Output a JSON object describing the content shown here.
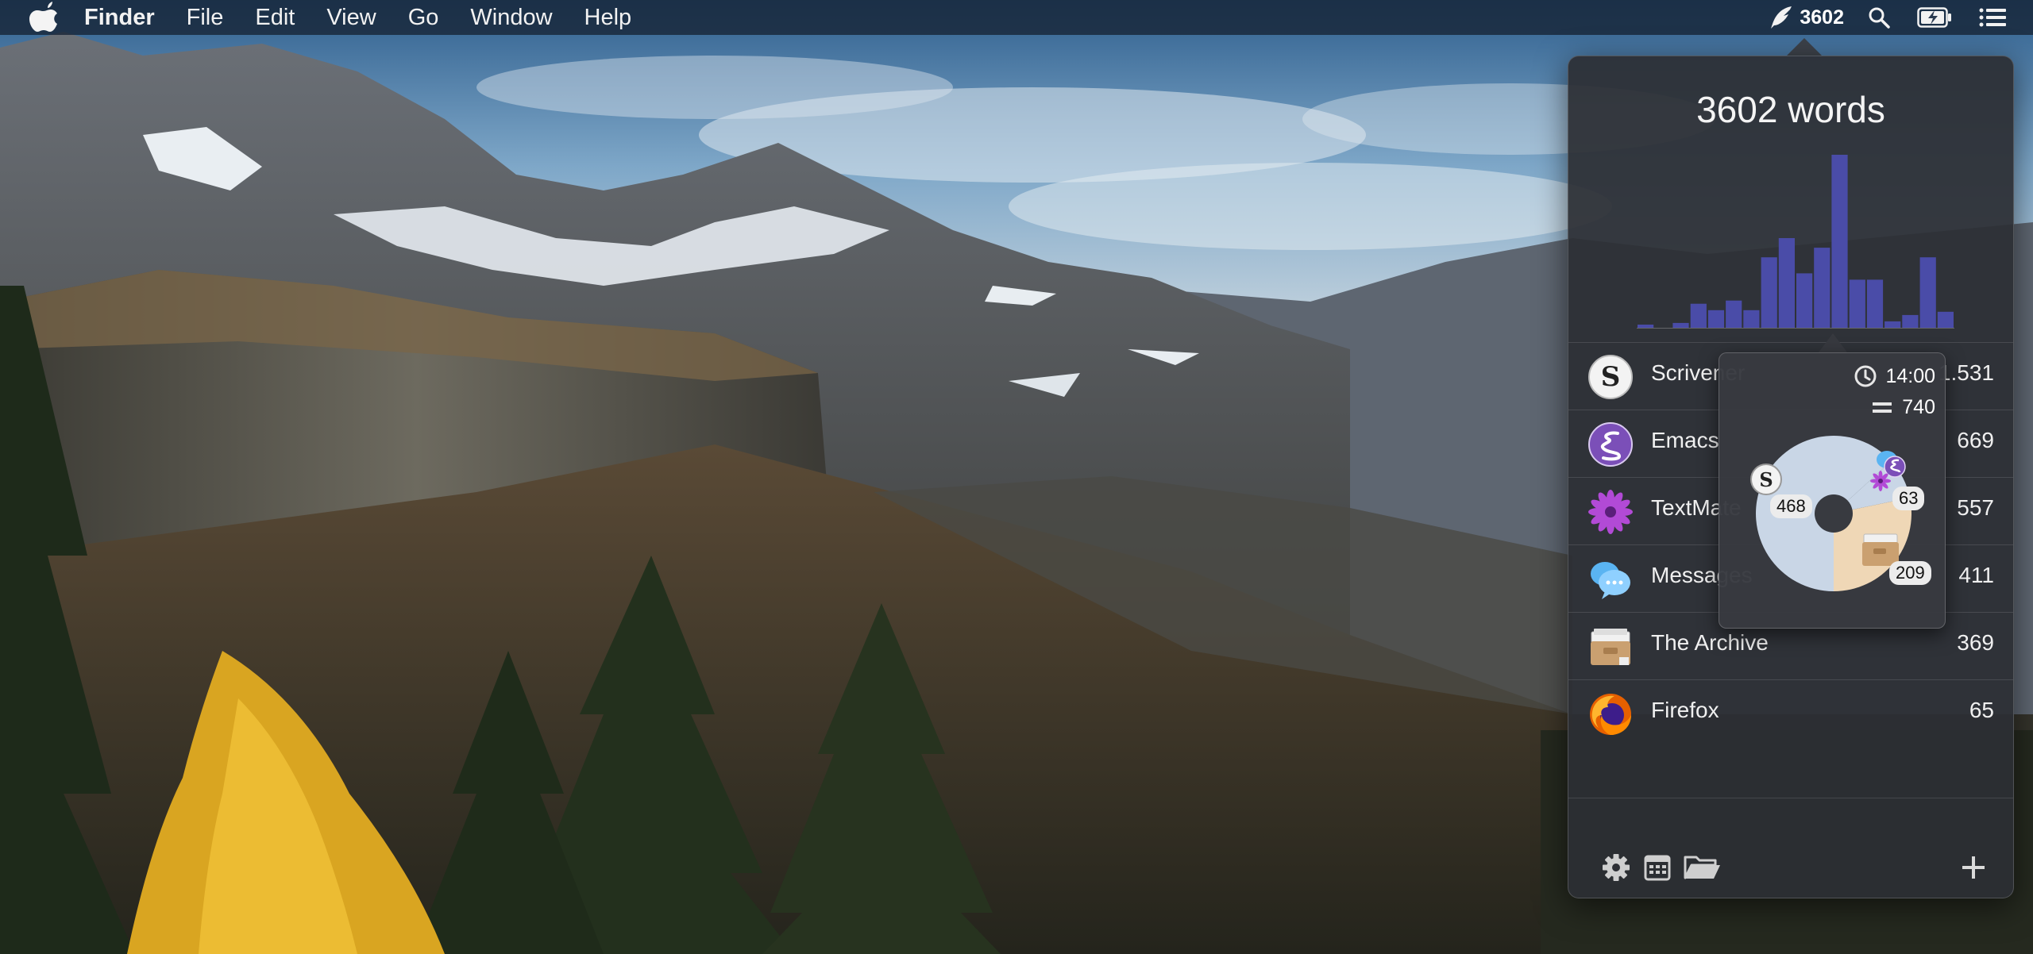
{
  "menubar": {
    "apple_icon": "apple-logo-icon",
    "app_name": "Finder",
    "menus": [
      "File",
      "Edit",
      "View",
      "Go",
      "Window",
      "Help"
    ],
    "status_word_count": "3602",
    "status_icons": [
      "quill-icon",
      "search-icon",
      "battery-charging-icon",
      "list-icon"
    ]
  },
  "popover": {
    "title": "3602 words",
    "histogram": {
      "type": "bar",
      "values": [
        2,
        0,
        3,
        15,
        11,
        17,
        11,
        44,
        56,
        34,
        50,
        108,
        30,
        30,
        4,
        8,
        44,
        10
      ],
      "color": "#4a4ca8"
    },
    "apps": [
      {
        "name": "Scrivener",
        "count": "1.531",
        "icon": "scrivener-icon"
      },
      {
        "name": "Emacs",
        "count": "669",
        "icon": "emacs-icon"
      },
      {
        "name": "TextMate",
        "count": "557",
        "icon": "textmate-icon"
      },
      {
        "name": "Messages",
        "count": "411",
        "icon": "messages-icon"
      },
      {
        "name": "The Archive",
        "count": "369",
        "icon": "the-archive-icon"
      },
      {
        "name": "Firefox",
        "count": "65",
        "icon": "firefox-icon"
      }
    ],
    "footer_icons": [
      "gear-icon",
      "calendar-icon",
      "folder-icon",
      "plus-icon"
    ]
  },
  "tooltip": {
    "time": "14:00",
    "total": "740",
    "slices": [
      {
        "label": "468",
        "value": 468,
        "color": "#c9d6e6"
      },
      {
        "label": "63",
        "value": 63,
        "color": "#c9d6e6"
      },
      {
        "label": "209",
        "value": 209,
        "color": "#efd7b6"
      }
    ]
  }
}
